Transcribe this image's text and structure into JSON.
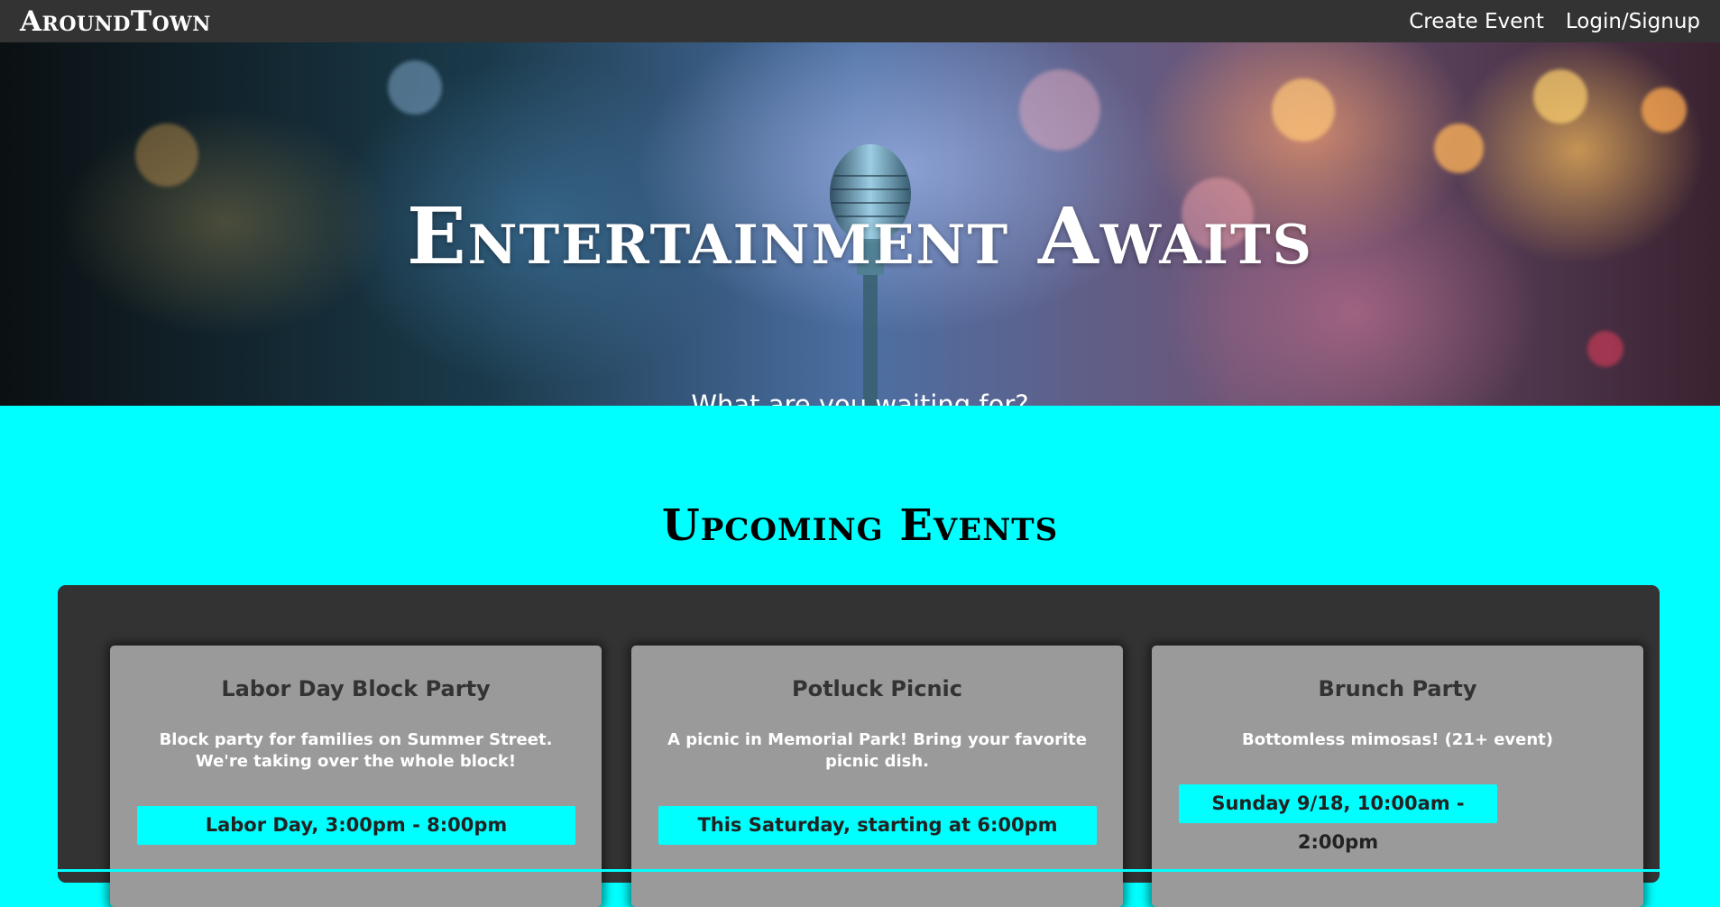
{
  "navbar": {
    "brand": "AroundTown",
    "links": [
      "Create Event",
      "Login/Signup"
    ]
  },
  "hero": {
    "title": "Entertainment Awaits",
    "subtitle": "What are you waiting for?"
  },
  "events_section": {
    "title": "Upcoming Events",
    "cards": [
      {
        "title": "Labor Day Block Party",
        "description": "Block party for families on Summer Street. We're taking over the whole block!",
        "time": "Labor Day, 3:00pm - 8:00pm"
      },
      {
        "title": "Potluck Picnic",
        "description": "A picnic in Memorial Park! Bring your favorite picnic dish.",
        "time": "This Saturday, starting at 6:00pm"
      },
      {
        "title": "Brunch Party",
        "description": "Bottomless mimosas! (21+ event)",
        "time": "Sunday 9/18, 10:00am - 2:00pm"
      }
    ]
  },
  "colors": {
    "navbar": "#333333",
    "page_background": "#00ffff",
    "panel": "#333333",
    "card": "#9a9a9a",
    "time_badge": "#00ffff"
  }
}
